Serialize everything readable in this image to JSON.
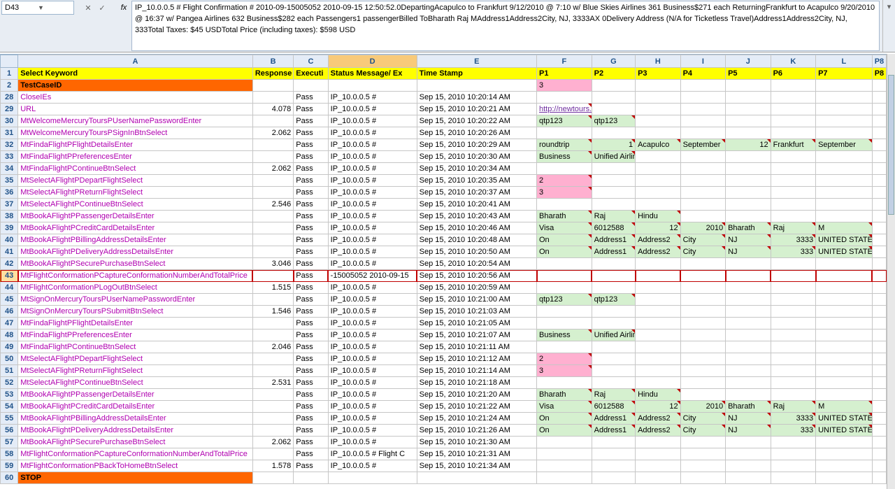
{
  "cellRef": "D43",
  "fx": "fx",
  "formulaText": "IP_10.0.0.5 # Flight Confirmation # 2010-09-15005052 2010-09-15 12:50:52.0DepartingAcapulco to Frankfurt 9/12/2010 @ 7:10 w/ Blue Skies Airlines 361 Business$271 each ReturningFrankfurt to Acapulco 9/20/2010 @ 16:37 w/ Pangea Airlines 632 Business$282 each Passengers1 passengerBilled ToBharath Raj MAddress1Address2City, NJ, 3333AX 0Delivery Address (N/A for Ticketless Travel)Address1Address2City, NJ, 333Total Taxes:  $45 USDTotal Price (including taxes):  $598 USD",
  "cols": [
    "A",
    "B",
    "C",
    "D",
    "E",
    "F",
    "G",
    "H",
    "I",
    "J",
    "K",
    "L",
    "M"
  ],
  "colLabels": {
    "F": "P1",
    "G": "P2",
    "H": "P3",
    "I": "P4",
    "J": "P5",
    "K": "P6",
    "L": "P7",
    "M": "P8"
  },
  "h": {
    "A": "Select Keyword",
    "B": "Response",
    "C": "Executi",
    "D": "Status Message/ Ex",
    "E": "Time Stamp"
  },
  "testCase": "TestCaseID",
  "stop": "STOP",
  "rows": [
    {
      "n": 28,
      "A": "CloseIEs",
      "C": "Pass",
      "D": "IP_10.0.0.5 #",
      "E": "Sep 15, 2010 10:20:14 AM"
    },
    {
      "n": 29,
      "A": "URL",
      "B": "4.078",
      "C": "Pass",
      "D": "IP_10.0.0.5 #",
      "E": "Sep 15, 2010 10:20:21 AM",
      "F": "http://newtours.demoaut.com/",
      "Fcls": "hyper"
    },
    {
      "n": 30,
      "A": "MtWelcomeMercuryToursPUserNamePasswordEnter",
      "C": "Pass",
      "D": "IP_10.0.0.5 #",
      "E": "Sep 15, 2010 10:20:22 AM",
      "F": "qtp123",
      "G": "qtp123",
      "Fcls": "green",
      "Gcls": "green"
    },
    {
      "n": 31,
      "A": "MtWelcomeMercuryToursPSignInBtnSelect",
      "B": "2.062",
      "C": "Pass",
      "D": "IP_10.0.0.5 #",
      "E": "Sep 15, 2010 10:20:26 AM"
    },
    {
      "n": 32,
      "A": "MtFindaFlightPFlightDetailsEnter",
      "C": "Pass",
      "D": "IP_10.0.0.5 #",
      "E": "Sep 15, 2010 10:20:29 AM",
      "F": "roundtrip",
      "G": "1",
      "H": "Acapulco",
      "I": "September",
      "J": "12",
      "K": "Frankfurt",
      "L": "September",
      "Fcls": "green",
      "Gcls": "green",
      "Hcls": "green",
      "Icls": "green",
      "Jcls": "green",
      "Kcls": "green",
      "Lcls": "green",
      "Gnum": 1,
      "Jnum": 1
    },
    {
      "n": 33,
      "A": "MtFindaFlightPPreferencesEnter",
      "C": "Pass",
      "D": "IP_10.0.0.5 #",
      "E": "Sep 15, 2010 10:20:30 AM",
      "F": "Business",
      "G": "Unified Airlines",
      "Fcls": "green",
      "Gcls": "green"
    },
    {
      "n": 34,
      "A": "MtFindaFlightPContinueBtnSelect",
      "B": "2.062",
      "C": "Pass",
      "D": "IP_10.0.0.5 #",
      "E": "Sep 15, 2010 10:20:34 AM"
    },
    {
      "n": 35,
      "A": "MtSelectAFlightPDepartFlightSelect",
      "C": "Pass",
      "D": "IP_10.0.0.5 #",
      "E": "Sep 15, 2010 10:20:35 AM",
      "F": "2",
      "Fcls": "pink"
    },
    {
      "n": 36,
      "A": "MtSelectAFlightPReturnFlightSelect",
      "C": "Pass",
      "D": "IP_10.0.0.5 #",
      "E": "Sep 15, 2010 10:20:37 AM",
      "F": "3",
      "Fcls": "pink"
    },
    {
      "n": 37,
      "A": "MtSelectAFlightPContinueBtnSelect",
      "B": "2.546",
      "C": "Pass",
      "D": "IP_10.0.0.5 #",
      "E": "Sep 15, 2010 10:20:41 AM"
    },
    {
      "n": 38,
      "A": "MtBookAFlightPPassengerDetailsEnter",
      "C": "Pass",
      "D": "IP_10.0.0.5 #",
      "E": "Sep 15, 2010 10:20:43 AM",
      "F": "Bharath",
      "G": "Raj",
      "H": "Hindu",
      "Fcls": "green",
      "Gcls": "green",
      "Hcls": "green"
    },
    {
      "n": 39,
      "A": "MtBookAFlightPCreditCardDetailsEnter",
      "C": "Pass",
      "D": "IP_10.0.0.5 #",
      "E": "Sep 15, 2010 10:20:46 AM",
      "F": "Visa",
      "G": "6012588",
      "H": "12",
      "I": "2010",
      "J": "Bharath",
      "K": "Raj",
      "L": "M",
      "Fcls": "green",
      "Gcls": "green",
      "Hcls": "green",
      "Icls": "green",
      "Jcls": "green",
      "Kcls": "green",
      "Lcls": "green",
      "Hnum": 1,
      "Inum": 1
    },
    {
      "n": 40,
      "A": "MtBookAFlightPBillingAddressDetailsEnter",
      "C": "Pass",
      "D": "IP_10.0.0.5 #",
      "E": "Sep 15, 2010 10:20:48 AM",
      "F": "On",
      "G": "Address1",
      "H": "Address2",
      "I": "City",
      "J": "NJ",
      "K": "3333",
      "L": "UNITED STATES",
      "Fcls": "green",
      "Gcls": "green",
      "Hcls": "green",
      "Icls": "green",
      "Jcls": "green",
      "Kcls": "green",
      "Lcls": "green",
      "Knum": 1
    },
    {
      "n": 41,
      "A": "MtBookAFlightPDeliveryAddressDetailsEnter",
      "C": "Pass",
      "D": "IP_10.0.0.5 #",
      "E": "Sep 15, 2010 10:20:50 AM",
      "F": "On",
      "G": "Address1",
      "H": "Address2",
      "I": "City",
      "J": "NJ",
      "K": "333",
      "L": "UNITED STATES",
      "Fcls": "green",
      "Gcls": "green",
      "Hcls": "green",
      "Icls": "green",
      "Jcls": "green",
      "Kcls": "green",
      "Lcls": "green",
      "Knum": 1
    },
    {
      "n": 42,
      "A": "MtBookAFlightPSecurePurchaseBtnSelect",
      "B": "3.046",
      "C": "Pass",
      "D": "IP_10.0.0.5 #",
      "E": "Sep 15, 2010 10:20:54 AM"
    },
    {
      "n": 43,
      "A": "MtFlightConformationPCaptureConformationNumberAndTotalPrice",
      "C": "Pass",
      "D": "-15005052 2010-09-15",
      "E": "Sep 15, 2010 10:20:56 AM",
      "active": true
    },
    {
      "n": 44,
      "A": "MtFlightConformationPLogOutBtnSelect",
      "B": "1.515",
      "C": "Pass",
      "D": "IP_10.0.0.5 #",
      "E": "Sep 15, 2010 10:20:59 AM"
    },
    {
      "n": 45,
      "A": "MtSignOnMercuryToursPUserNamePasswordEnter",
      "C": "Pass",
      "D": "IP_10.0.0.5 #",
      "E": "Sep 15, 2010 10:21:00 AM",
      "F": "qtp123",
      "G": "qtp123",
      "Fcls": "green",
      "Gcls": "green"
    },
    {
      "n": 46,
      "A": "MtSignOnMercuryToursPSubmitBtnSelect",
      "B": "1.546",
      "C": "Pass",
      "D": "IP_10.0.0.5 #",
      "E": "Sep 15, 2010 10:21:03 AM"
    },
    {
      "n": 47,
      "A": "MtFindaFlightPFlightDetailsEnter",
      "C": "Pass",
      "D": "IP_10.0.0.5 #",
      "E": "Sep 15, 2010 10:21:05 AM"
    },
    {
      "n": 48,
      "A": "MtFindaFlightPPreferencesEnter",
      "C": "Pass",
      "D": "IP_10.0.0.5 #",
      "E": "Sep 15, 2010 10:21:07 AM",
      "F": "Business",
      "G": "Unified Airlines",
      "Fcls": "green",
      "Gcls": "green"
    },
    {
      "n": 49,
      "A": "MtFindaFlightPContinueBtnSelect",
      "B": "2.046",
      "C": "Pass",
      "D": "IP_10.0.0.5 #",
      "E": "Sep 15, 2010 10:21:11 AM"
    },
    {
      "n": 50,
      "A": "MtSelectAFlightPDepartFlightSelect",
      "C": "Pass",
      "D": "IP_10.0.0.5 #",
      "E": "Sep 15, 2010 10:21:12 AM",
      "F": "2",
      "Fcls": "pink"
    },
    {
      "n": 51,
      "A": "MtSelectAFlightPReturnFlightSelect",
      "C": "Pass",
      "D": "IP_10.0.0.5 #",
      "E": "Sep 15, 2010 10:21:14 AM",
      "F": "3",
      "Fcls": "pink"
    },
    {
      "n": 52,
      "A": "MtSelectAFlightPContinueBtnSelect",
      "B": "2.531",
      "C": "Pass",
      "D": "IP_10.0.0.5 #",
      "E": "Sep 15, 2010 10:21:18 AM"
    },
    {
      "n": 53,
      "A": "MtBookAFlightPPassengerDetailsEnter",
      "C": "Pass",
      "D": "IP_10.0.0.5 #",
      "E": "Sep 15, 2010 10:21:20 AM",
      "F": "Bharath",
      "G": "Raj",
      "H": "Hindu",
      "Fcls": "green",
      "Gcls": "green",
      "Hcls": "green"
    },
    {
      "n": 54,
      "A": "MtBookAFlightPCreditCardDetailsEnter",
      "C": "Pass",
      "D": "IP_10.0.0.5 #",
      "E": "Sep 15, 2010 10:21:22 AM",
      "F": "Visa",
      "G": "6012588",
      "H": "12",
      "I": "2010",
      "J": "Bharath",
      "K": "Raj",
      "L": "M",
      "Fcls": "green",
      "Gcls": "green",
      "Hcls": "green",
      "Icls": "green",
      "Jcls": "green",
      "Kcls": "green",
      "Lcls": "green",
      "Hnum": 1,
      "Inum": 1
    },
    {
      "n": 55,
      "A": "MtBookAFlightPBillingAddressDetailsEnter",
      "C": "Pass",
      "D": "IP_10.0.0.5 #",
      "E": "Sep 15, 2010 10:21:24 AM",
      "F": "On",
      "G": "Address1",
      "H": "Address2",
      "I": "City",
      "J": "NJ",
      "K": "3333",
      "L": "UNITED STATES",
      "Fcls": "green",
      "Gcls": "green",
      "Hcls": "green",
      "Icls": "green",
      "Jcls": "green",
      "Kcls": "green",
      "Lcls": "green",
      "Knum": 1
    },
    {
      "n": 56,
      "A": "MtBookAFlightPDeliveryAddressDetailsEnter",
      "C": "Pass",
      "D": "IP_10.0.0.5 #",
      "E": "Sep 15, 2010 10:21:26 AM",
      "F": "On",
      "G": "Address1",
      "H": "Address2",
      "I": "City",
      "J": "NJ",
      "K": "333",
      "L": "UNITED STATES",
      "Fcls": "green",
      "Gcls": "green",
      "Hcls": "green",
      "Icls": "green",
      "Jcls": "green",
      "Kcls": "green",
      "Lcls": "green",
      "Knum": 1
    },
    {
      "n": 57,
      "A": "MtBookAFlightPSecurePurchaseBtnSelect",
      "B": "2.062",
      "C": "Pass",
      "D": "IP_10.0.0.5 #",
      "E": "Sep 15, 2010 10:21:30 AM"
    },
    {
      "n": 58,
      "A": "MtFlightConformationPCaptureConformationNumberAndTotalPrice",
      "C": "Pass",
      "D": "IP_10.0.0.5 #  Flight C",
      "E": "Sep 15, 2010 10:21:31 AM"
    },
    {
      "n": 59,
      "A": "MtFlightConformationPBackToHomeBtnSelect",
      "B": "1.578",
      "C": "Pass",
      "D": "IP_10.0.0.5 #",
      "E": "Sep 15, 2010 10:21:34 AM"
    }
  ],
  "pinkRow2": "3"
}
